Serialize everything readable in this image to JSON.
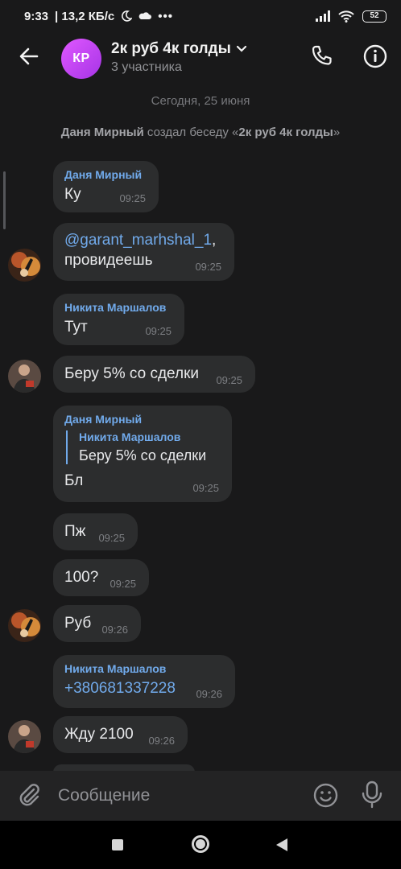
{
  "status_bar": {
    "time": "9:33",
    "speed": "13,2 КБ/с",
    "battery": "52",
    "dots": "•••"
  },
  "header": {
    "avatar_initials": "КР",
    "title": "2к руб 4к голды",
    "subtitle": "3 участника"
  },
  "feed": {
    "date": "Сегодня, 25 июня",
    "system": {
      "author": "Даня Мирный",
      "action": " создал беседу «",
      "chat_name": "2к руб 4к голды",
      "close": "»"
    },
    "messages": [
      {
        "sender": "Даня Мирный",
        "text": "Ку",
        "time": "09:25"
      },
      {
        "mention": "@garant_marhshal_1",
        "text_after": ",",
        "text_line2": "провидеешь",
        "time": "09:25"
      },
      {
        "sender": "Никита Маршалов",
        "text": "Тут",
        "time": "09:25"
      },
      {
        "text": "Беру 5% со сделки",
        "time": "09:25"
      },
      {
        "sender": "Даня Мирный",
        "reply_sender": "Никита Маршалов",
        "reply_text": "Беру 5% со сделки",
        "text": "Бл",
        "time": "09:25"
      },
      {
        "text": "Пж",
        "time": "09:25"
      },
      {
        "text": "100?",
        "time": "09:25"
      },
      {
        "text": "Руб",
        "time": "09:26"
      },
      {
        "sender": "Никита Маршалов",
        "phone": "+380681337228",
        "time": "09:26"
      },
      {
        "text": "Жду 2100",
        "time": "09:26"
      }
    ]
  },
  "composer": {
    "placeholder": "Сообщение"
  },
  "colors": {
    "background": "#19191a",
    "bubble": "#2c2d2e",
    "accent": "#71aaeb",
    "avatar_gradient_start": "#e058ff",
    "avatar_gradient_end": "#a634e6"
  },
  "icons": [
    "back-arrow-icon",
    "chevron-down-icon",
    "phone-icon",
    "info-icon",
    "paperclip-icon",
    "emoji-icon",
    "microphone-icon"
  ]
}
